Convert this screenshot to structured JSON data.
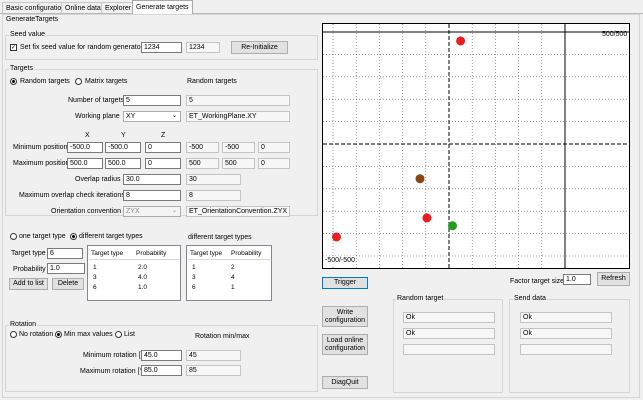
{
  "tabs": [
    "Basic configurations",
    "Online data",
    "Explorer",
    "Generate targets"
  ],
  "group_title": "GenerateTargets",
  "seed": {
    "title": "Seed value",
    "checkbox_label": "Set fix seed value for random generator",
    "checked": true,
    "value": "1234",
    "display": "1234",
    "reinit_label": "Re-Initialize"
  },
  "targets": {
    "title": "Targets",
    "random_label": "Random targets",
    "matrix_label": "Matrix targets",
    "mode_display": "Random targets",
    "num_label": "Number of targets",
    "num_value": "5",
    "num_display": "5",
    "plane_label": "Working plane",
    "plane_value": "XY",
    "plane_display": "ET_WorkingPlane.XY",
    "col_x": "X",
    "col_y": "Y",
    "col_z": "Z",
    "min_label": "Minimum position",
    "min_values": [
      "-500.0",
      "-500.0",
      "0"
    ],
    "min_display": [
      "-500",
      "-500",
      "0"
    ],
    "max_label": "Maximum position",
    "max_values": [
      "500.0",
      "500.0",
      "0"
    ],
    "max_display": [
      "500",
      "500",
      "0"
    ],
    "overlap_label": "Overlap radius",
    "overlap_value": "30.0",
    "overlap_display": "30",
    "iter_label": "Maximum overlap check iterations",
    "iter_value": "8",
    "iter_display": "8",
    "orient_label": "Orientation convention",
    "orient_value": "ZYX",
    "orient_display": "ET_OrientationConvention.ZYX"
  },
  "types": {
    "one_label": "one target type",
    "diff_label": "different target types",
    "diff_display": "different target types",
    "type_label": "Target type",
    "type_value": "6",
    "prob_label": "Probability",
    "prob_value": "1.0",
    "add_label": "Add to list",
    "delete_label": "Delete",
    "list_headers": [
      "Target type",
      "Probability"
    ],
    "list_rows": [
      [
        "1",
        "2.0"
      ],
      [
        "3",
        "4.0"
      ],
      [
        "6",
        "1.0"
      ]
    ],
    "display_headers": [
      "Target type",
      "Probability"
    ],
    "display_rows": [
      [
        "1",
        "2"
      ],
      [
        "3",
        "4"
      ],
      [
        "6",
        "1"
      ]
    ]
  },
  "rotation": {
    "title": "Rotation",
    "no_label": "No rotation",
    "minmax_label": "Min max values",
    "list_label": "List",
    "display_header": "Rotation min/max",
    "min_label": "Minimum rotation [°]",
    "min_value": "45.0",
    "min_display": "45",
    "max_label": "Maximum rotation [°]",
    "max_value": "85.0",
    "max_display": "85"
  },
  "plot": {
    "top_right_label": "500/500",
    "bottom_left_label": "-500/-500",
    "xlim": [
      -500,
      500
    ],
    "ylim": [
      -500,
      500
    ],
    "grid": true,
    "points": [
      {
        "x": 50,
        "y": 460,
        "color": "#ee1c1c"
      },
      {
        "x": -125,
        "y": -155,
        "color": "#8b4513"
      },
      {
        "x": -95,
        "y": -330,
        "color": "#ee1c1c"
      },
      {
        "x": 15,
        "y": -365,
        "color": "#1e9e1e"
      },
      {
        "x": -485,
        "y": -415,
        "color": "#ee1c1c"
      }
    ]
  },
  "controls": {
    "trigger_label": "Trigger",
    "factor_label": "Factor target size",
    "factor_value": "1.0",
    "refresh_label": "Refresh",
    "write_label": "Write\nconfiguration",
    "load_label": "Load online\nconfiguration",
    "diagquit_label": "DiagQuit",
    "random_target_title": "Random target",
    "random_target_values": [
      "Ok",
      "Ok",
      ""
    ],
    "send_title": "Send data",
    "send_values": [
      "Ok",
      "Ok",
      ""
    ]
  }
}
